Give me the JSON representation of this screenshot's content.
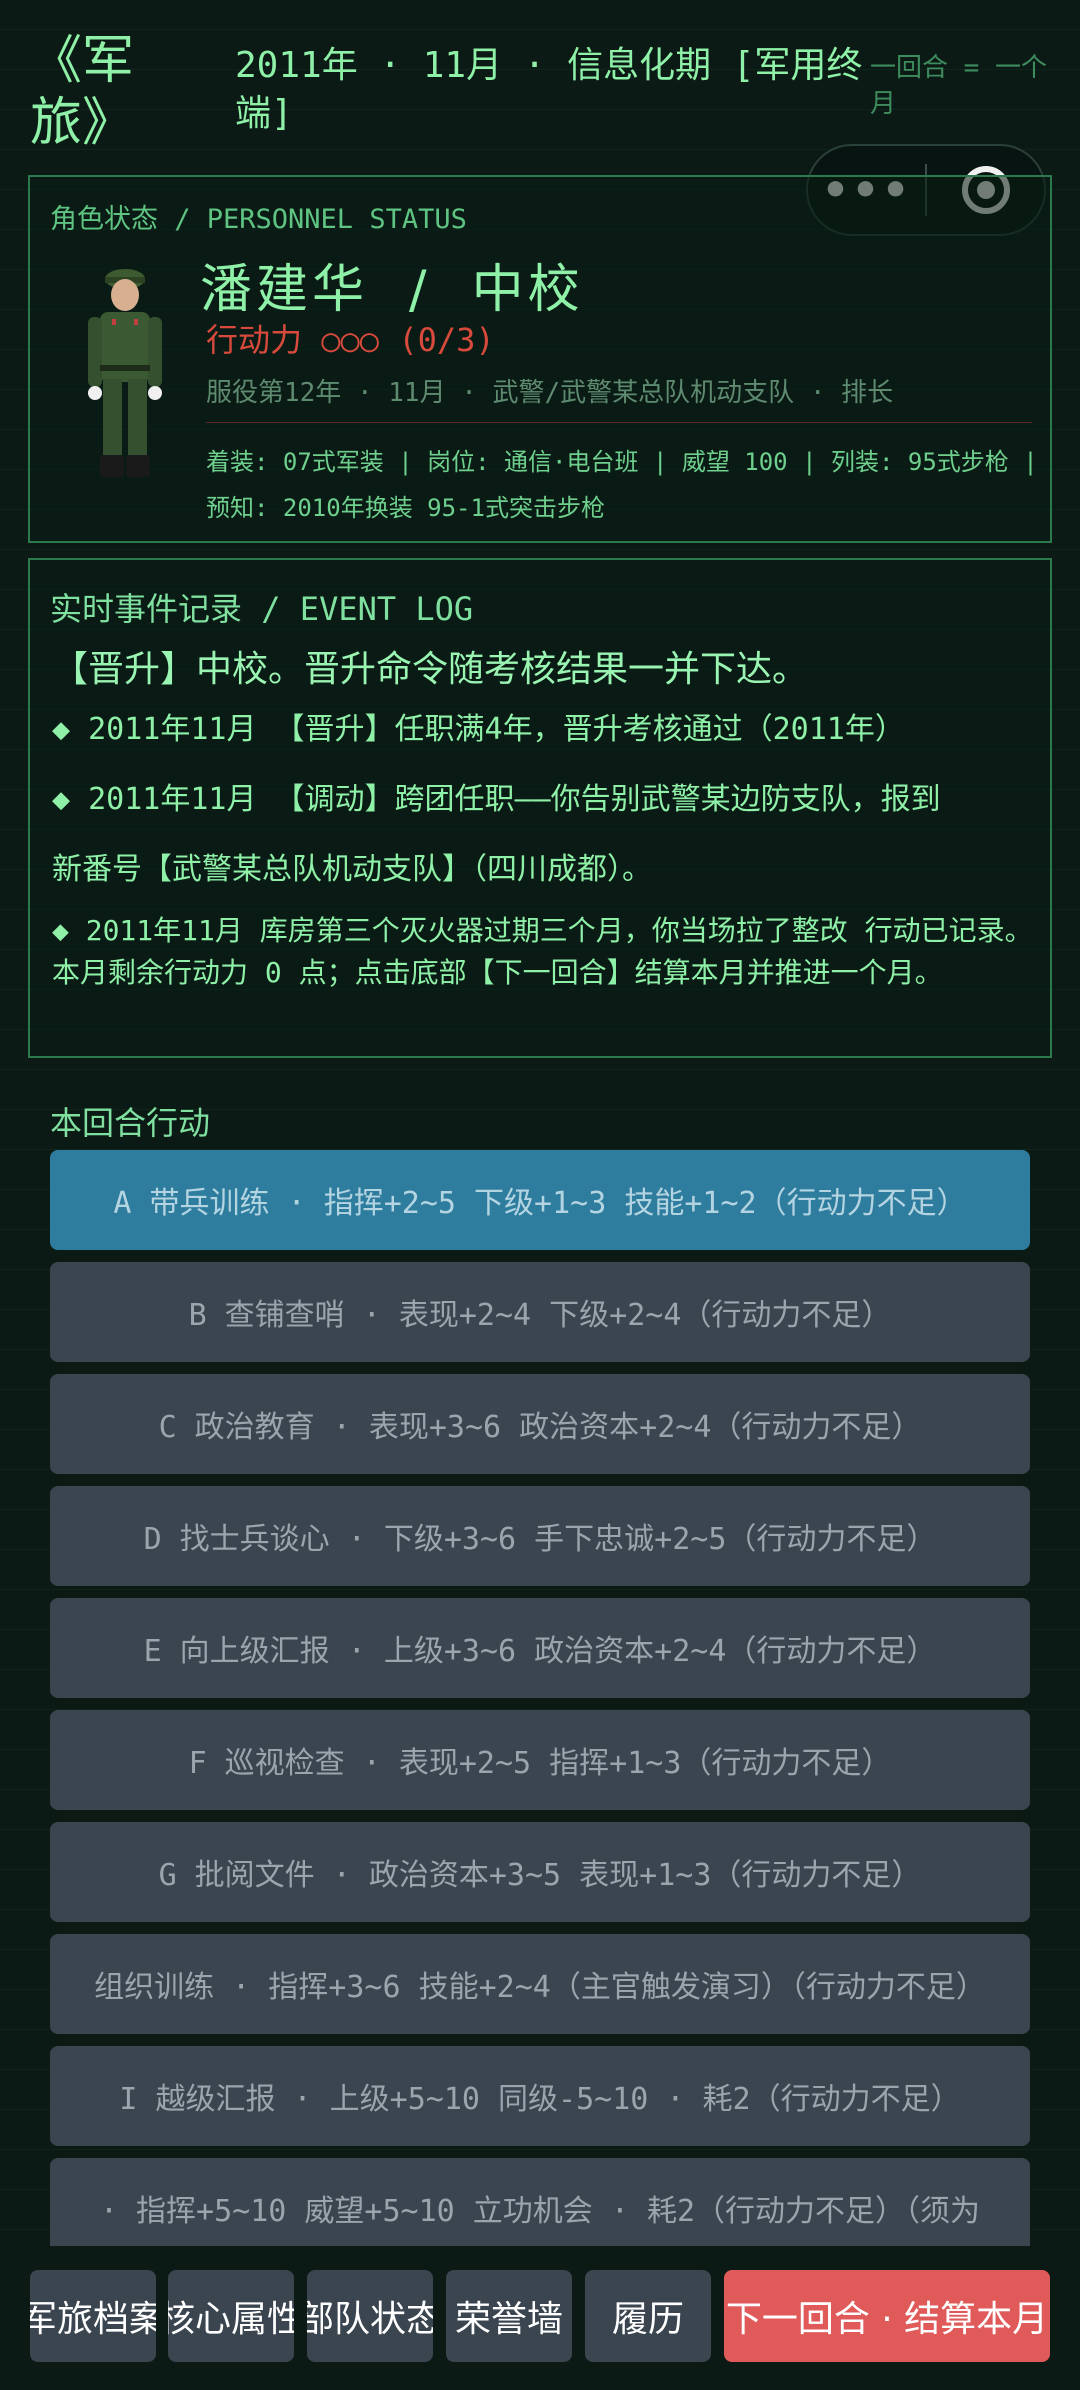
{
  "header": {
    "title": "《军旅》",
    "subtitle": "2011年 · 11月 · 信息化期 [军用终端]",
    "turn_hint": "一回合 = 一个月"
  },
  "miniapp_capsule": {
    "more_icon": "more-dots-icon",
    "close_icon": "target-circle-icon"
  },
  "status": {
    "heading": "角色状态 / PERSONNEL STATUS",
    "name_rank": "潘建华  /  中校",
    "action_points": "行动力 ○○○ (0/3)",
    "service": "服役第12年 · 11月 · 武警/武警某总队机动支队 · 排长",
    "equipment": "着装: 07式军装 | 岗位: 通信·电台班 | 威望 100 | 列装: 95式步枪 | 预知: 2010年换装 95-1式突击步枪",
    "colors": {
      "action_points": "#d84a3c",
      "accent": "#8ff0a8"
    }
  },
  "event_log": {
    "heading": "实时事件记录 / EVENT LOG",
    "headline": "【晋升】中校。晋升命令随考核结果一并下达。",
    "entries": [
      "◆ 2011年11月 【晋升】任职满4年，晋升考核通过（2011年）",
      "◆ 2011年11月 【调动】跨团任职——你告别武警某边防支队，报到",
      "新番号【武警某总队机动支队】（四川成都）。"
    ],
    "note": "◆ 2011年11月 库房第三个灭火器过期三个月，你当场拉了整改 行动已记录。本月剩余行动力 0 点；点击底部【下一回合】结算本月并推进一个月。"
  },
  "actions": {
    "label": "本回合行动",
    "items": [
      "A  带兵训练 · 指挥+2~5 下级+1~3 技能+1~2（行动力不足）",
      "B  查铺查哨 · 表现+2~4 下级+2~4（行动力不足）",
      "C  政治教育 · 表现+3~6 政治资本+2~4（行动力不足）",
      "D  找士兵谈心 · 下级+3~6 手下忠诚+2~5（行动力不足）",
      "E  向上级汇报 · 上级+3~6 政治资本+2~4（行动力不足）",
      "F  巡视检查 · 表现+2~5 指挥+1~3（行动力不足）",
      "G  批阅文件 · 政治资本+3~5 表现+1~3（行动力不足）",
      "组织训练 · 指挥+3~6 技能+2~4（主官触发演习）（行动力不足）",
      "I  越级汇报 · 上级+5~10 同级-5~10 · 耗2（行动力不足）",
      "· 指挥+5~10 威望+5~10 立功机会 · 耗2（行动力不足）（须为"
    ]
  },
  "bottom_tabs": {
    "archive": "军旅档案",
    "attributes": "核心属性",
    "unit": "部队状态",
    "honor": "荣誉墙",
    "resume": "履历",
    "next_turn": "下一回合 · 结算本月"
  }
}
